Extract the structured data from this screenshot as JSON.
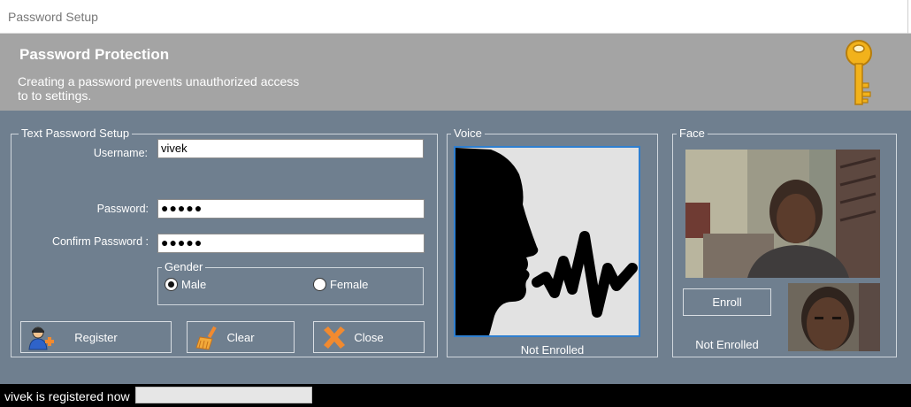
{
  "window": {
    "title": "Password Setup"
  },
  "header": {
    "title": "Password Protection",
    "description": "Creating a password prevents unauthorized access to to settings."
  },
  "text_password": {
    "legend": "Text Password Setup",
    "username_label": "Username:",
    "username_value": "vivek",
    "password_label": "Password:",
    "password_value": "●●●●●",
    "confirm_label": "Confirm Password :",
    "confirm_value": "●●●●●",
    "gender": {
      "legend": "Gender",
      "options": [
        "Male",
        "Female"
      ],
      "selected": "Male"
    },
    "buttons": {
      "register": "Register",
      "clear": "Clear",
      "close": "Close"
    }
  },
  "voice": {
    "legend": "Voice",
    "status": "Not Enrolled"
  },
  "face": {
    "legend": "Face",
    "enroll_label": "Enroll",
    "status": "Not Enrolled"
  },
  "status": {
    "message": "vivek is registered now",
    "progress": 0
  },
  "icons": {
    "key": "key-icon",
    "register": "add-user-icon",
    "clear": "broom-icon",
    "close": "close-x-icon",
    "voice": "speaking-head-icon"
  },
  "colors": {
    "panel_bg": "#6f7f8f",
    "header_bg": "#a4a4a4",
    "close_icon": "#f28a2f",
    "key_gold": "#f2b21b",
    "voice_border": "#2f7fd0"
  }
}
